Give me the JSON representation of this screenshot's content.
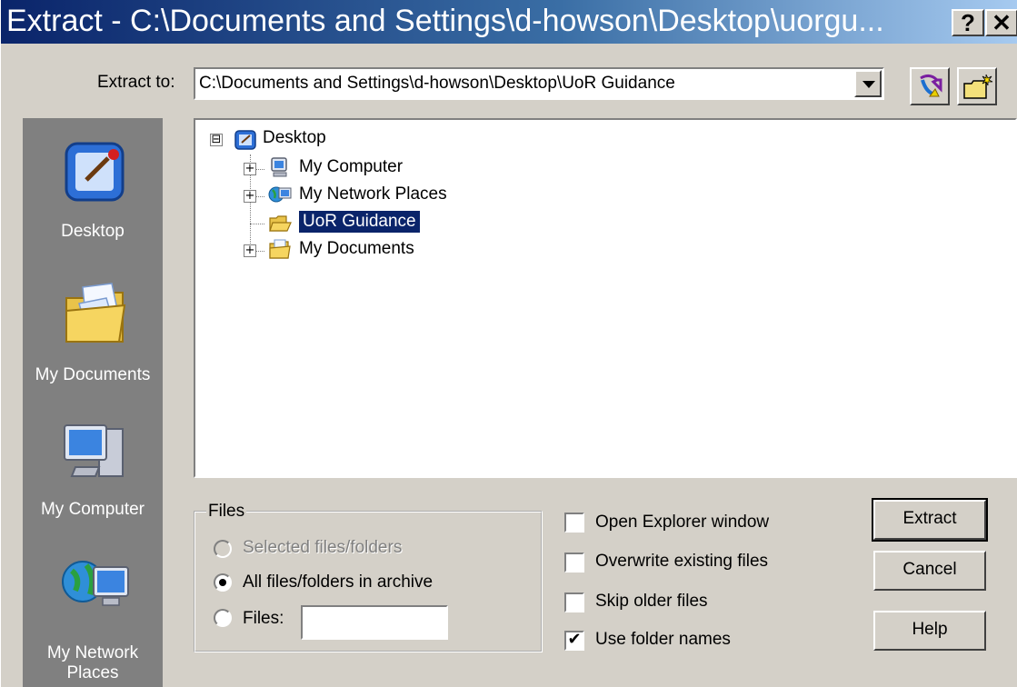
{
  "window": {
    "title": "Extract - C:\\Documents and Settings\\d-howson\\Desktop\\uorgu...",
    "help_glyph": "?",
    "close_glyph": "✕"
  },
  "extract_to": {
    "label": "Extract to:",
    "value": "C:\\Documents and Settings\\d-howson\\Desktop\\UoR Guidance"
  },
  "toolbar": {
    "icons": [
      "navigate-icon",
      "new-folder-icon"
    ]
  },
  "places": [
    {
      "label": "Desktop",
      "icon": "desktop-icon"
    },
    {
      "label": "My Documents",
      "icon": "my-documents-icon"
    },
    {
      "label": "My Computer",
      "icon": "my-computer-icon"
    },
    {
      "label": "My Network Places",
      "icon": "network-places-icon"
    }
  ],
  "tree": {
    "root": {
      "label": "Desktop",
      "expander": "⊟"
    },
    "items": [
      {
        "label": "My Computer",
        "expander": "+"
      },
      {
        "label": "My Network Places",
        "expander": "+"
      },
      {
        "label": "UoR Guidance",
        "expander": "",
        "selected": true
      },
      {
        "label": "My Documents",
        "expander": "+"
      }
    ]
  },
  "files_group": {
    "legend": "Files",
    "options": [
      {
        "label": "Selected files/folders",
        "checked": false,
        "disabled": true
      },
      {
        "label": "All files/folders in archive",
        "checked": true,
        "disabled": false
      },
      {
        "label": "Files:",
        "checked": false,
        "disabled": false
      }
    ],
    "files_value": ""
  },
  "checkboxes": [
    {
      "label": "Open Explorer window",
      "checked": false,
      "mark": ""
    },
    {
      "label": "Overwrite existing files",
      "checked": false,
      "mark": ""
    },
    {
      "label": "Skip older files",
      "checked": false,
      "mark": ""
    },
    {
      "label": "Use folder names",
      "checked": true,
      "mark": "✔"
    }
  ],
  "buttons": {
    "extract": "Extract",
    "cancel": "Cancel",
    "help": "Help"
  }
}
